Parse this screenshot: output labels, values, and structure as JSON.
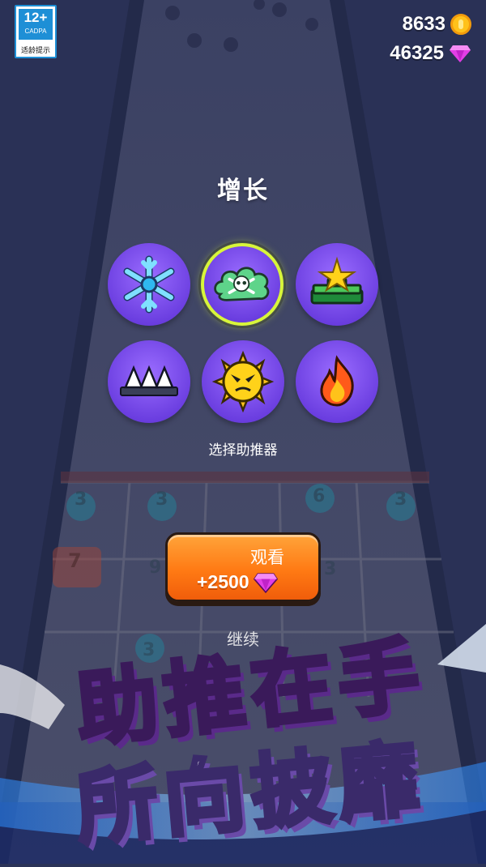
{
  "age_rating": {
    "age": "12+",
    "org": "CADPA",
    "caption": "适龄提示"
  },
  "currency": {
    "coins": {
      "value": "8633",
      "icon": "coin-icon"
    },
    "gems": {
      "value": "46325",
      "icon": "gem-icon"
    }
  },
  "title": "增长",
  "boosters": [
    {
      "name": "snowflake",
      "icon": "snowflake-icon",
      "selected": false
    },
    {
      "name": "poison-cloud",
      "icon": "skull-crossbones-icon",
      "selected": true
    },
    {
      "name": "star-pad",
      "icon": "star-pad-icon",
      "selected": false
    },
    {
      "name": "spikes",
      "icon": "spikes-icon",
      "selected": false
    },
    {
      "name": "spiky-ball",
      "icon": "angry-spike-ball-icon",
      "selected": false
    },
    {
      "name": "fire",
      "icon": "fire-icon",
      "selected": false
    }
  ],
  "subtitle": "选择助推器",
  "watch_button": {
    "label": "观看",
    "reward": "+2500",
    "reward_icon": "gem-icon"
  },
  "continue_label": "继续",
  "promo": {
    "line1": "助推在手",
    "line2": "所向披靡"
  },
  "background_numbers": [
    "3",
    "3",
    "6",
    "3",
    "7",
    "9",
    "3",
    "3"
  ],
  "colors": {
    "accent_orange": "#ff7a14",
    "selection_ring": "#d8f53a",
    "booster_purple": "#7a4cf0",
    "banner_yellow": "#ffd43a"
  }
}
